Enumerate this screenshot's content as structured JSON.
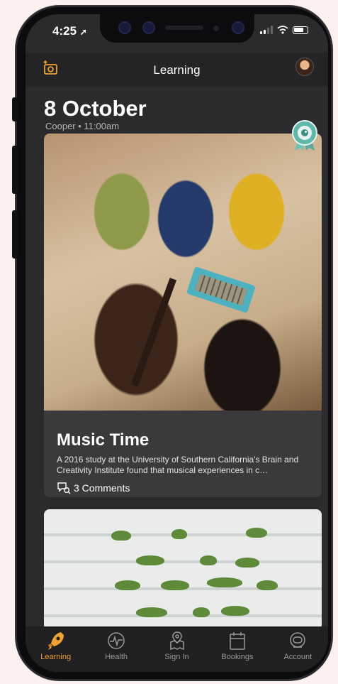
{
  "status": {
    "time": "4:25"
  },
  "nav": {
    "title": "Learning",
    "camera_icon": "camera-add-icon",
    "avatar_icon": "avatar-icon"
  },
  "feed": {
    "date": "8 October",
    "meta": "Cooper  • 11:00am",
    "badge_icon": "robot-award-badge-icon",
    "cards": [
      {
        "title": "Music Time",
        "description": "A 2016 study at the University of Southern California's Brain and Creativity Institute found that musical experiences in c…",
        "comments": "3 Comments"
      }
    ]
  },
  "tabs": [
    {
      "label": "Learning",
      "icon": "rocket-icon",
      "active": true
    },
    {
      "label": "Health",
      "icon": "heartbeat-icon",
      "active": false
    },
    {
      "label": "Sign In",
      "icon": "map-pin-icon",
      "active": false
    },
    {
      "label": "Bookings",
      "icon": "calendar-icon",
      "active": false
    },
    {
      "label": "Account",
      "icon": "astronaut-helmet-icon",
      "active": false
    }
  ],
  "colors": {
    "accent": "#f0a236",
    "background": "#2b2b2d",
    "card": "#3a3a3c"
  }
}
